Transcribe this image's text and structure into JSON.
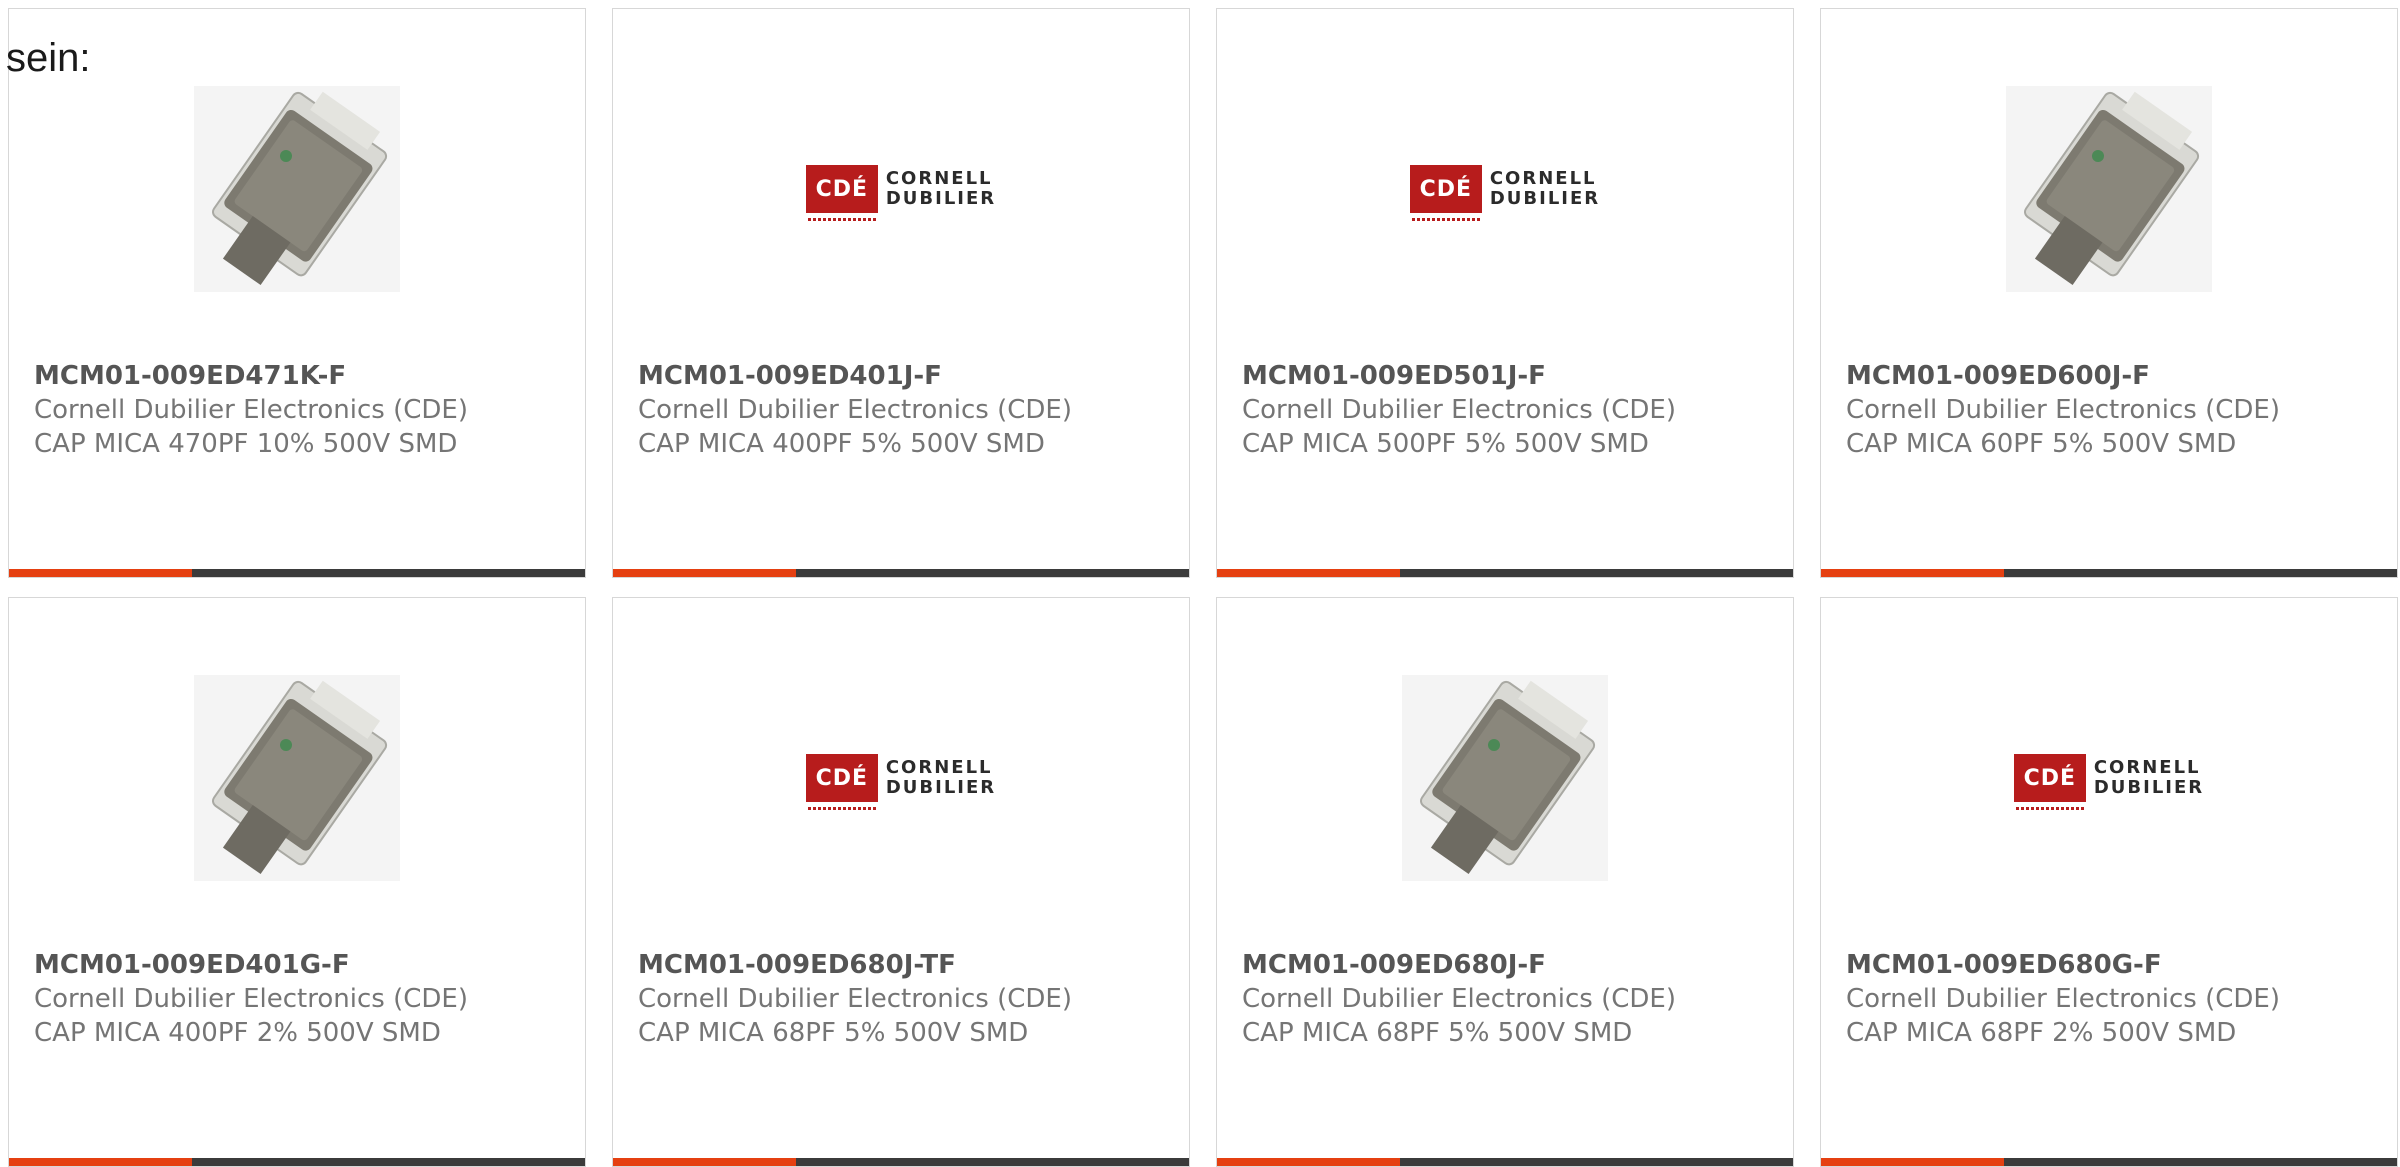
{
  "intro_text": "sein:",
  "logo": {
    "mark": "CDÉ",
    "line1": "CORNELL",
    "line2": "DUBILIER"
  },
  "colors": {
    "accent": "#e54011",
    "bar_dark": "#3b3b3b",
    "logo_red": "#b71c1c"
  },
  "products": [
    {
      "part_number": "MCM01-009ED471K-F",
      "manufacturer": "Cornell Dubilier Electronics (CDE)",
      "description": "CAP MICA 470PF 10% 500V SMD",
      "image": "capacitor-photo"
    },
    {
      "part_number": "MCM01-009ED401J-F",
      "manufacturer": "Cornell Dubilier Electronics (CDE)",
      "description": "CAP MICA 400PF 5% 500V SMD",
      "image": "cde-logo"
    },
    {
      "part_number": "MCM01-009ED501J-F",
      "manufacturer": "Cornell Dubilier Electronics (CDE)",
      "description": "CAP MICA 500PF 5% 500V SMD",
      "image": "cde-logo"
    },
    {
      "part_number": "MCM01-009ED600J-F",
      "manufacturer": "Cornell Dubilier Electronics (CDE)",
      "description": "CAP MICA 60PF 5% 500V SMD",
      "image": "capacitor-photo"
    },
    {
      "part_number": "MCM01-009ED401G-F",
      "manufacturer": "Cornell Dubilier Electronics (CDE)",
      "description": "CAP MICA 400PF 2% 500V SMD",
      "image": "capacitor-photo"
    },
    {
      "part_number": "MCM01-009ED680J-TF",
      "manufacturer": "Cornell Dubilier Electronics (CDE)",
      "description": "CAP MICA 68PF 5% 500V SMD",
      "image": "cde-logo"
    },
    {
      "part_number": "MCM01-009ED680J-F",
      "manufacturer": "Cornell Dubilier Electronics (CDE)",
      "description": "CAP MICA 68PF 5% 500V SMD",
      "image": "capacitor-photo"
    },
    {
      "part_number": "MCM01-009ED680G-F",
      "manufacturer": "Cornell Dubilier Electronics (CDE)",
      "description": "CAP MICA 68PF 2% 500V SMD",
      "image": "cde-logo"
    }
  ]
}
